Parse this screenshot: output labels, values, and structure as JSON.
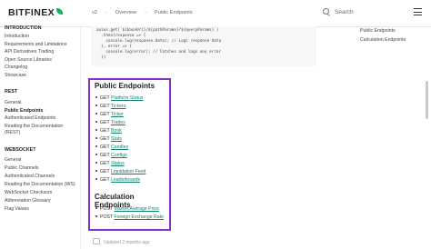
{
  "brand": {
    "name": "BITFINEX"
  },
  "breadcrumbs": [
    "v2",
    "Overview",
    "Public Endpoints"
  ],
  "search": {
    "placeholder": "Search"
  },
  "sidebar": {
    "sections": [
      {
        "title": "INTRODUCTION",
        "items": [
          "Introduction",
          "Requirements and Limitations",
          "API Derivatives Trading",
          "Open Source Libraries",
          "Changelog",
          "Showcase"
        ]
      },
      {
        "title": "REST",
        "items": [
          "General",
          "Public Endpoints",
          "Authenticated Endpoints",
          "Reading the Documentation",
          "(REST)"
        ]
      },
      {
        "title": "WEBSOCKET",
        "items": [
          "General",
          "Public Channels",
          "Authenticated Channels",
          "Reading the Documentation (WS)",
          "WebSocket Checksum",
          "Abbreviation Glossary",
          "Flag Values"
        ]
      }
    ],
    "active": "Public Endpoints"
  },
  "code_lines": [
    "axios.get(`${baseUrl}/${pathParams}?${queryParams}`)",
    "  .then(response => {",
    "    console.log(response.data); // Logs response data",
    "  }, error => {",
    "    console.log(error); // Catches and logs any error",
    "  })"
  ],
  "public_endpoints": {
    "title": "Public Endpoints",
    "items": [
      {
        "method": "GET",
        "label": "Platform Status"
      },
      {
        "method": "GET",
        "label": "Tickers"
      },
      {
        "method": "GET",
        "label": "Ticker"
      },
      {
        "method": "GET",
        "label": "Trades"
      },
      {
        "method": "GET",
        "label": "Book"
      },
      {
        "method": "GET",
        "label": "Stats"
      },
      {
        "method": "GET",
        "label": "Candles"
      },
      {
        "method": "GET",
        "label": "Configs"
      },
      {
        "method": "GET",
        "label": "Status"
      },
      {
        "method": "GET",
        "label": "Liquidation Feed"
      },
      {
        "method": "GET",
        "label": "Leaderboards"
      }
    ]
  },
  "calculation_endpoints": {
    "title": "Calculation Endpoints",
    "items": [
      {
        "method": "POST",
        "label": "Market Average Price"
      },
      {
        "method": "POST",
        "label": "Foreign Exchange Rate"
      }
    ]
  },
  "updated": "Updated 2 months ago",
  "toc": [
    "Public Endpoints",
    "Calculation Endpoints"
  ],
  "colors": {
    "link": "#127f6b",
    "highlight": "#8b2fc9",
    "brand_leaf": "#16b157"
  }
}
